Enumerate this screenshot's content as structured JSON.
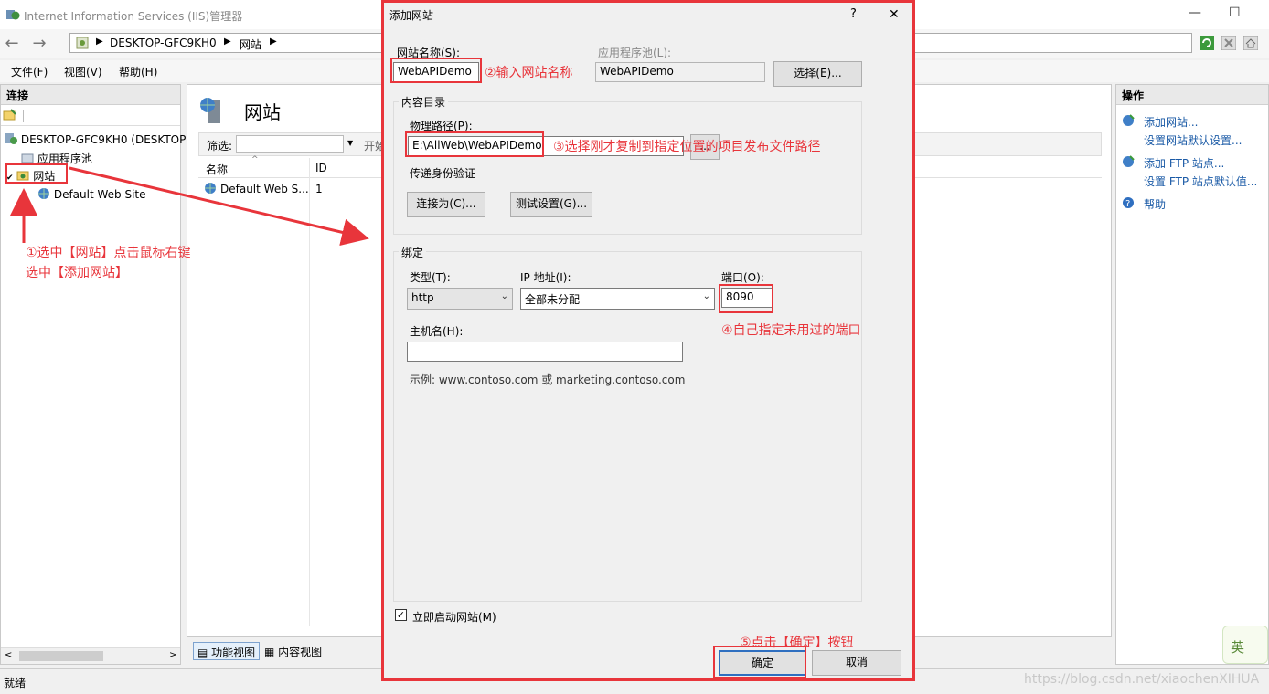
{
  "window": {
    "title": "Internet Information Services (IIS)管理器",
    "minimize": "—",
    "maximize": "☐"
  },
  "address": {
    "segments": [
      "DESKTOP-GFC9KH0",
      "网站"
    ]
  },
  "menu": [
    {
      "label": "文件(F)"
    },
    {
      "label": "视图(V)"
    },
    {
      "label": "帮助(H)"
    }
  ],
  "connections": {
    "title": "连接",
    "tree": {
      "root": "DESKTOP-GFC9KH0 (DESKTOP",
      "app_pools": "应用程序池",
      "sites": "网站",
      "default_site": "Default Web Site"
    }
  },
  "main": {
    "title": "网站",
    "filter_label": "筛选:",
    "filter_go": "开始",
    "columns": [
      "名称",
      "ID"
    ],
    "rows": [
      {
        "name": "Default Web S...",
        "id": "1"
      }
    ],
    "view_tabs": [
      "功能视图",
      "内容视图"
    ]
  },
  "actions": {
    "title": "操作",
    "items": [
      {
        "label": "添加网站...",
        "sub": "设置网站默认设置..."
      },
      {
        "label": "添加 FTP 站点...",
        "sub": "设置 FTP 站点默认值..."
      },
      {
        "label": "帮助",
        "sub": ""
      }
    ]
  },
  "status": {
    "text": "就绪"
  },
  "dialog": {
    "title": "添加网站",
    "help": "?",
    "close": "✕",
    "site_name_label": "网站名称(S):",
    "site_name_value": "WebAPIDemo",
    "app_pool_label": "应用程序池(L):",
    "app_pool_value": "WebAPIDemo",
    "select_button": "选择(E)...",
    "content_dir_title": "内容目录",
    "physical_path_label": "物理路径(P):",
    "physical_path_value": "E:\\AllWeb\\WebAPIDemo",
    "browse_button": "...",
    "pass_through_label": "传递身份验证",
    "connect_as_button": "连接为(C)...",
    "test_settings_button": "测试设置(G)...",
    "binding_title": "绑定",
    "type_label": "类型(T):",
    "type_value": "http",
    "ip_label": "IP 地址(I):",
    "ip_value": "全部未分配",
    "port_label": "端口(O):",
    "port_value": "8090",
    "hostname_label": "主机名(H):",
    "hostname_value": "",
    "example_text": "示例: www.contoso.com 或 marketing.contoso.com",
    "start_immediately_label": "立即启动网站(M)",
    "start_immediately_checked": true,
    "ok_button": "确定",
    "cancel_button": "取消"
  },
  "annotations": {
    "step1_line1": "①选中【网站】点击鼠标右键",
    "step1_line2": "选中【添加网站】",
    "step2": "②输入网站名称",
    "step3": "③选择刚才复制到指定位置的项目发布文件路径",
    "step4": "④自己指定未用过的端口",
    "step5": "⑤点击【确定】按钮"
  },
  "ime": {
    "label": "英"
  },
  "watermark": "https://blog.csdn.net/xiaochenXIHUA",
  "colors": {
    "annotation_red": "#e8353b",
    "link_blue": "#1a5aa6"
  }
}
